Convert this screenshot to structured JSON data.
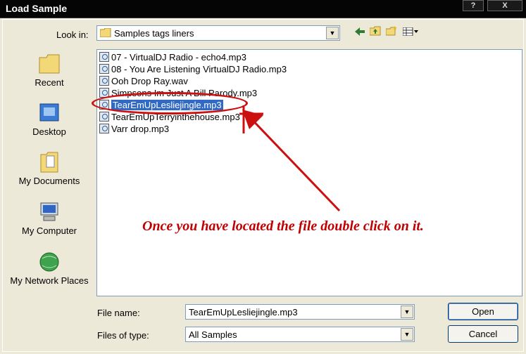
{
  "window": {
    "title": "Load Sample",
    "help_label": "?",
    "close_label": "X"
  },
  "lookin": {
    "label": "Look in:",
    "value": "Samples tags liners"
  },
  "places": [
    {
      "label": "Recent"
    },
    {
      "label": "Desktop"
    },
    {
      "label": "My Documents"
    },
    {
      "label": "My Computer"
    },
    {
      "label": "My Network Places"
    }
  ],
  "files": [
    {
      "name": "07 - VirtualDJ Radio - echo4.mp3"
    },
    {
      "name": "08 - You Are Listening VirtualDJ Radio.mp3"
    },
    {
      "name": "Ooh Drop Ray.wav"
    },
    {
      "name": "Simpsons Im Just A Bill Parody.mp3"
    },
    {
      "name": "TearEmUpLesliejingle.mp3"
    },
    {
      "name": "TearEmUpTerryinthehouse.mp3"
    },
    {
      "name": "Varr drop.mp3"
    }
  ],
  "annotation": {
    "text": "Once you have located the file double click on it.",
    "color": "#c00000"
  },
  "filename": {
    "label": "File name:",
    "value": "TearEmUpLesliejingle.mp3"
  },
  "filetype": {
    "label": "Files of type:",
    "value": "All Samples"
  },
  "buttons": {
    "open": "Open",
    "cancel": "Cancel"
  },
  "colors": {
    "selection": "#316ac5",
    "annotation_red": "#cc1010"
  }
}
